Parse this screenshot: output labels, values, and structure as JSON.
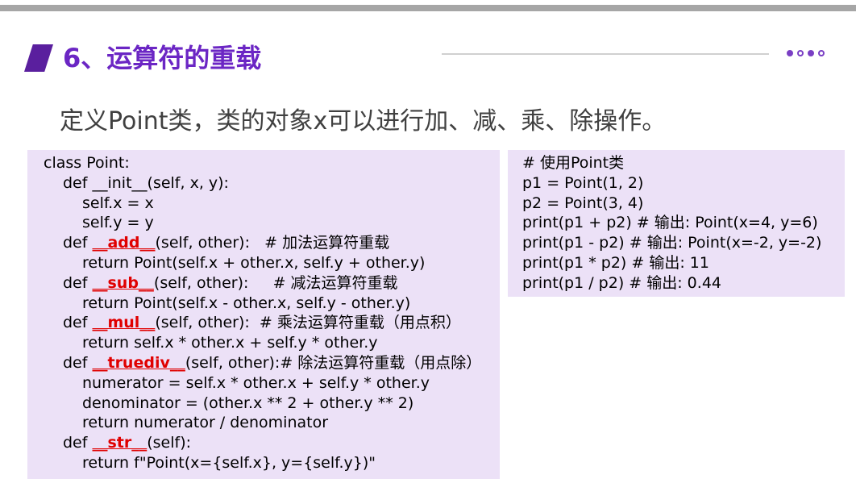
{
  "slide": {
    "title": "6、运算符的重载",
    "subtitle": "定义Point类，类的对象x可以进行加、减、乘、除操作。"
  },
  "colors": {
    "title": "#6b26c4",
    "title_mark": "#5a1f9e",
    "code_bg": "#ece1f7",
    "highlight": "#e00000",
    "top_bar": "#a6a6a6"
  },
  "icons": {
    "title_mark": "parallelogram-mark",
    "pager": "dots-indicator"
  },
  "code_left": {
    "line1": "class Point:",
    "line2": "def __init__(self, x, y):",
    "line3": "self.x = x",
    "line4": "self.y = y",
    "line5_pre": "def ",
    "line5_kw": "__add__",
    "line5_post": "(self, other):   # 加法运算符重载",
    "line6": "return Point(self.x + other.x, self.y + other.y)",
    "line7_pre": "def ",
    "line7_kw": "__sub__",
    "line7_post": "(self, other):     # 减法运算符重载",
    "line8": "return Point(self.x - other.x, self.y - other.y)",
    "line9_pre": "def ",
    "line9_kw": "__mul__",
    "line9_post": "(self, other):  # 乘法运算符重载（用点积）",
    "line10": "return self.x * other.x + self.y * other.y",
    "line11_pre": "def ",
    "line11_kw": "__truediv__",
    "line11_post": "(self, other):# 除法运算符重载（用点除）",
    "line12": "numerator = self.x * other.x + self.y * other.y",
    "line13": "denominator = (other.x ** 2 + other.y ** 2)",
    "line14": "return numerator / denominator",
    "line15_pre": "def ",
    "line15_kw": "__str__",
    "line15_post": "(self):",
    "line16": "return f\"Point(x={self.x}, y={self.y})\""
  },
  "code_right": {
    "line1": "# 使用Point类",
    "line2": "p1 = Point(1, 2)",
    "line3": "p2 = Point(3, 4)",
    "line4": "print(p1 + p2) # 输出: Point(x=4, y=6)",
    "line5": "print(p1 - p2) # 输出: Point(x=-2, y=-2)",
    "line6": "print(p1 * p2) # 输出: 11",
    "line7": "print(p1 / p2) # 输出: 0.44"
  }
}
